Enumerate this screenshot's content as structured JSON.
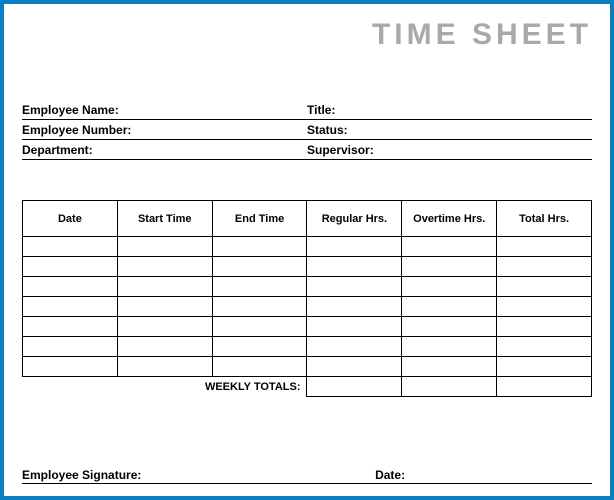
{
  "title": "TIME SHEET",
  "info": {
    "left": [
      {
        "label": "Employee Name:"
      },
      {
        "label": "Employee Number:"
      },
      {
        "label": "Department:"
      }
    ],
    "right": [
      {
        "label": "Title:"
      },
      {
        "label": "Status:"
      },
      {
        "label": "Supervisor:"
      }
    ]
  },
  "table": {
    "headers": [
      "Date",
      "Start Time",
      "End Time",
      "Regular Hrs.",
      "Overtime Hrs.",
      "Total Hrs."
    ],
    "row_count": 7,
    "weekly_totals_label": "WEEKLY TOTALS:"
  },
  "footer": {
    "signature_label": "Employee Signature:",
    "date_label": "Date:"
  }
}
